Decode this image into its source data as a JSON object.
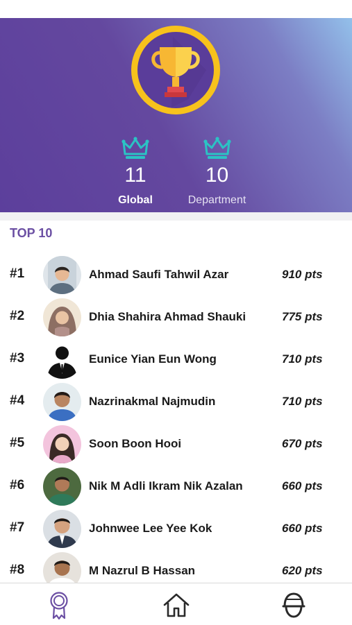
{
  "stats": {
    "global": {
      "value": "11",
      "label": "Global"
    },
    "department": {
      "value": "10",
      "label": "Department"
    }
  },
  "section_title": "TOP 10",
  "leaderboard": [
    {
      "rank": "#1",
      "name": "Ahmad Saufi Tahwil Azar",
      "points": "910 pts"
    },
    {
      "rank": "#2",
      "name": "Dhia Shahira Ahmad Shauki",
      "points": "775 pts"
    },
    {
      "rank": "#3",
      "name": "Eunice Yian Eun Wong",
      "points": "710 pts"
    },
    {
      "rank": "#4",
      "name": "Nazrinakmal Najmudin",
      "points": "710 pts"
    },
    {
      "rank": "#5",
      "name": "Soon Boon Hooi",
      "points": "670 pts"
    },
    {
      "rank": "#6",
      "name": "Nik M Adli Ikram Nik Azalan",
      "points": "660 pts"
    },
    {
      "rank": "#7",
      "name": "Johnwee Lee Yee Kok",
      "points": "660 pts"
    },
    {
      "rank": "#8",
      "name": "M Nazrul B Hassan",
      "points": "620 pts"
    }
  ],
  "tabs": [
    {
      "icon": "award-ribbon-icon",
      "active": true
    },
    {
      "icon": "home-icon",
      "active": false
    },
    {
      "icon": "user-helmet-icon",
      "active": false
    }
  ],
  "colors": {
    "accent": "#6b4fa3",
    "crown": "#2bc3c4",
    "trophy_ring": "#f7c21c",
    "trophy_inner": "#5a3d9a"
  }
}
